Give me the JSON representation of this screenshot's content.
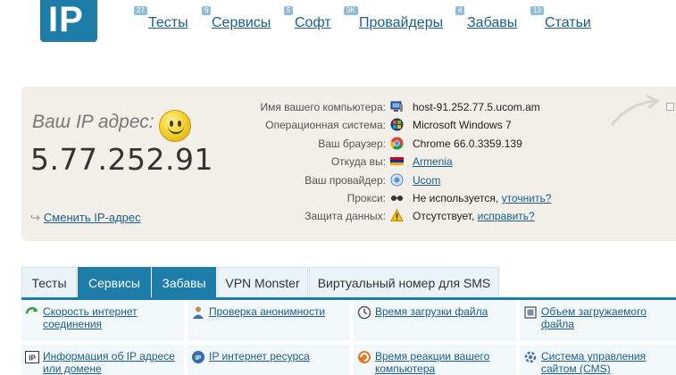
{
  "logo": {
    "text": "IP"
  },
  "nav": [
    {
      "label": "Тесты",
      "badge": "27"
    },
    {
      "label": "Сервисы",
      "badge": "9"
    },
    {
      "label": "Софт",
      "badge": "5"
    },
    {
      "label": "Провайдеры",
      "badge": "3K"
    },
    {
      "label": "Забавы",
      "badge": "4"
    },
    {
      "label": "Статьи",
      "badge": "13"
    }
  ],
  "ip": {
    "label": "Ваш IP адрес:",
    "value": "5.77.252.91",
    "change_link": "Сменить IP-адрес"
  },
  "info": [
    {
      "key": "Имя вашего компьютера:",
      "icon": "computer-icon",
      "value": "host-91.252.77.5.ucom.am"
    },
    {
      "key": "Операционная система:",
      "icon": "windows-icon",
      "value": "Microsoft Windows 7"
    },
    {
      "key": "Ваш браузер:",
      "icon": "chrome-icon",
      "value": "Chrome 66.0.3359.139"
    },
    {
      "key": "Откуда вы:",
      "icon": "flag-armenia-icon",
      "value": "Armenia"
    },
    {
      "key": "Ваш провайдер:",
      "icon": "provider-icon",
      "value": "Ucom"
    },
    {
      "key": "Прокси:",
      "icon": "glasses-icon",
      "value": "Не используется,",
      "link": "уточнить?"
    },
    {
      "key": "Защита данных:",
      "icon": "warning-icon",
      "value": "Отсутствует,",
      "link": "исправить?"
    }
  ],
  "tabs": [
    {
      "label": "Тесты",
      "active": false
    },
    {
      "label": "Сервисы",
      "active": true
    },
    {
      "label": "Забавы",
      "active": true
    },
    {
      "label": "VPN Monster",
      "active": false
    },
    {
      "label": "Виртуальный номер для SMS",
      "active": false
    }
  ],
  "services": [
    {
      "label": "Скорость интернет соединения",
      "icon": "speed-arrow-icon"
    },
    {
      "label": "Проверка анонимности",
      "icon": "person-icon"
    },
    {
      "label": "Время загрузки файла",
      "icon": "clock-icon"
    },
    {
      "label": "Объем загружаемого файла",
      "icon": "file-size-icon"
    },
    {
      "label": "Информация об IP адресе или домене",
      "icon": "ip-info-icon"
    },
    {
      "label": "IP интернет ресурса",
      "icon": "ip-resource-icon"
    },
    {
      "label": "Время реакции вашего компьютера",
      "icon": "reaction-icon"
    },
    {
      "label": "Система управления сайтом (CMS)",
      "icon": "cms-icon"
    }
  ],
  "colors": {
    "brand": "#1d7ca8",
    "link": "#1a5f8a",
    "panel": "#f2eee8"
  }
}
